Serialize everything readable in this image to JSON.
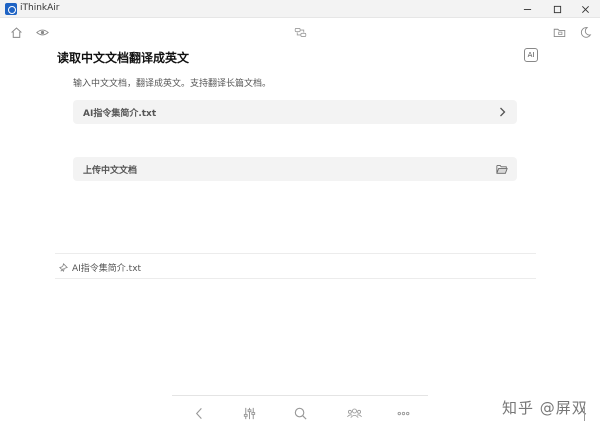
{
  "window": {
    "title": "iThinkAir",
    "minimize_icon": "minimize-icon",
    "maximize_icon": "maximize-icon",
    "close_icon": "close-icon"
  },
  "toolbar": {
    "left_icons": [
      "home-icon",
      "eye-icon"
    ],
    "center_icon": "swap-icon",
    "right_icons": [
      "folder-icon",
      "moon-icon"
    ]
  },
  "page": {
    "title": "读取中文文档翻译成英文",
    "ai_badge": "AI",
    "subtitle": "输入中文文档，翻译成英文。支持翻译长篇文档。"
  },
  "prompt_row": {
    "label": "AI指令集简介.txt",
    "trail_icon": "chevron-right-icon"
  },
  "upload_row": {
    "label": "上传中文文档",
    "trail_icon": "open-folder-icon"
  },
  "result": {
    "file_name": "AI指令集简介.txt",
    "icon": "pin-icon"
  },
  "bottom_nav": [
    "back-icon",
    "sliders-icon",
    "search-icon",
    "group-icon",
    "more-icon"
  ],
  "watermark": {
    "text": "知乎 @屏双"
  },
  "colors": {
    "accent": "#1e63c4",
    "row_bg": "#f3f3f3",
    "muted_text": "#555555"
  }
}
